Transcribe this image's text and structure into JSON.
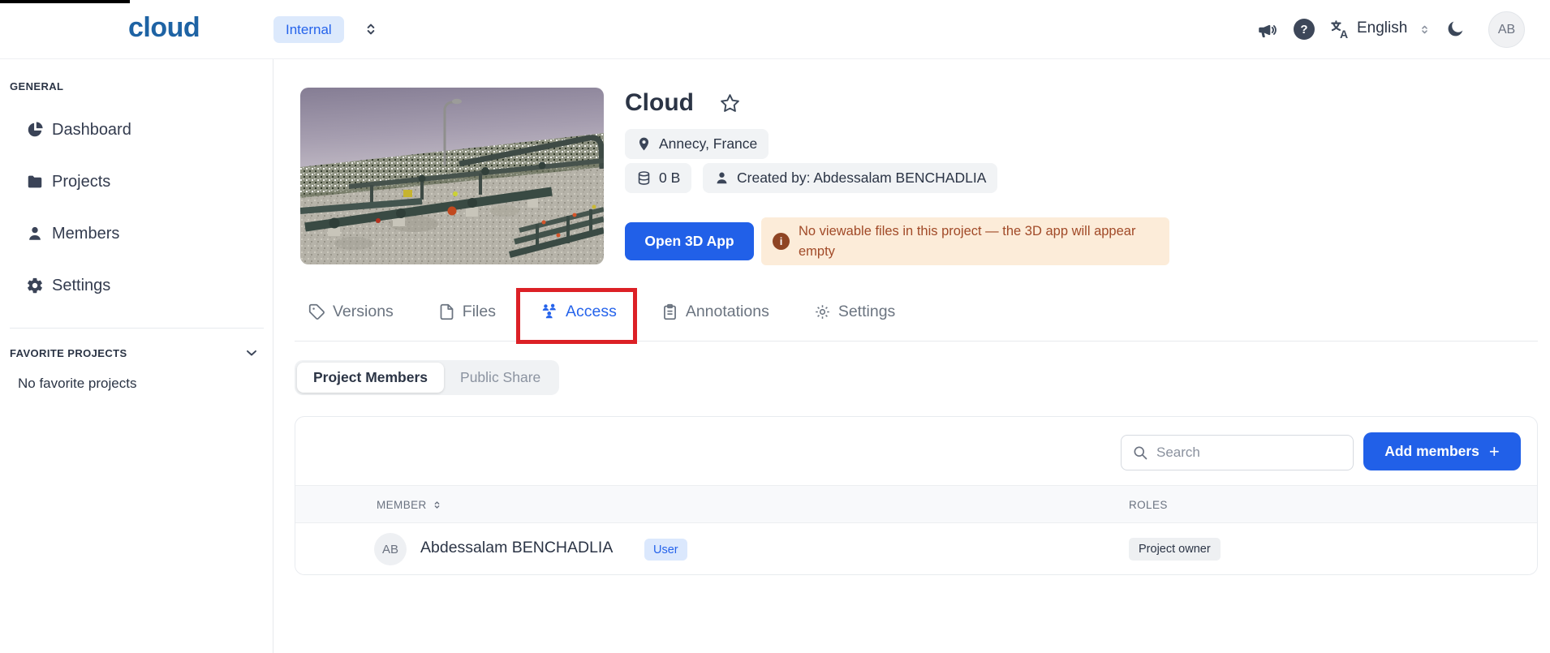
{
  "colors": {
    "accent_blue": "#2563eb",
    "button_blue": "#2160e8",
    "navy_text": "#2b3445",
    "warning_bg": "#fcecd9",
    "warning_text": "#a14a28",
    "annotation_red": "#dc2026",
    "badge_gray_bg": "#f1f3f5",
    "user_badge_bg": "#dbe8fd"
  },
  "navbar": {
    "logo": "cloud",
    "workspace": "Internal",
    "language": "English",
    "avatar_initials": "AB",
    "help_glyph": "?",
    "icons": [
      "megaphone-icon",
      "help-icon",
      "translate-icon",
      "moon-icon"
    ]
  },
  "sidebar": {
    "section_general": "GENERAL",
    "items": [
      {
        "label": "Dashboard",
        "icon": "pie-chart-icon"
      },
      {
        "label": "Projects",
        "icon": "folder-icon"
      },
      {
        "label": "Members",
        "icon": "user-icon"
      },
      {
        "label": "Settings",
        "icon": "gear-icon"
      }
    ],
    "section_favorites": "FAVORITE PROJECTS",
    "favorites_empty": "No favorite projects"
  },
  "project": {
    "title": "Cloud",
    "location": "Annecy, France",
    "size": "0 B",
    "created_by": "Created by: Abdessalam BENCHADLIA",
    "open_app_button": "Open 3D App",
    "warning_text": "No viewable files in this project — the 3D app will appear empty",
    "warning_icon_glyph": "i"
  },
  "tabs": [
    {
      "label": "Versions",
      "icon": "tag-icon",
      "active": false
    },
    {
      "label": "Files",
      "icon": "file-icon",
      "active": false
    },
    {
      "label": "Access",
      "icon": "users-icon",
      "active": true,
      "annotated": true
    },
    {
      "label": "Annotations",
      "icon": "clipboard-icon",
      "active": false
    },
    {
      "label": "Settings",
      "icon": "gear-outline-icon",
      "active": false
    }
  ],
  "subtabs": {
    "active": "Project Members",
    "inactive": "Public Share"
  },
  "members_panel": {
    "search_placeholder": "Search",
    "add_button": "Add members",
    "add_button_glyph": "+",
    "col_member": "MEMBER",
    "col_roles": "ROLES",
    "rows": [
      {
        "initials": "AB",
        "name": "Abdessalam BENCHADLIA",
        "type_badge": "User",
        "role_badge": "Project owner"
      }
    ]
  }
}
